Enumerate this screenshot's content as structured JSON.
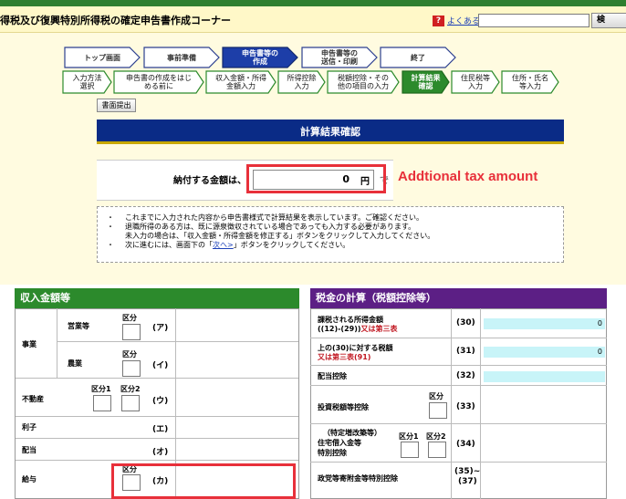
{
  "header": {
    "title": "得税及び復興特別所得税の確定申告書作成コーナー",
    "faq_icon": "?",
    "faq_label": "よくある質問",
    "search_placeholder": "",
    "search_button": "検"
  },
  "main_steps": [
    {
      "label": "トップ画面",
      "active": false
    },
    {
      "label": "事前準備",
      "active": false
    },
    {
      "label": "申告書等の\n作成",
      "active": true
    },
    {
      "label": "申告書等の\n送信・印刷",
      "active": false
    },
    {
      "label": "終了",
      "active": false
    }
  ],
  "sub_steps": [
    {
      "label": "入力方法\n選択",
      "active": false
    },
    {
      "label": "申告書の作成をはじ\nめる前に",
      "active": false
    },
    {
      "label": "収入金額・所得\n金額入力",
      "active": false
    },
    {
      "label": "所得控除\n入力",
      "active": false
    },
    {
      "label": "税額控除・その\n他の項目の入力",
      "active": false
    },
    {
      "label": "計算結果\n確認",
      "active": true
    },
    {
      "label": "住民税等\n入力",
      "active": false
    },
    {
      "label": "住所・氏名\n等入力",
      "active": false
    }
  ],
  "print_button": "書面提出",
  "page_title": "計算結果確認",
  "payment": {
    "label": "納付する金額は、",
    "value": "0",
    "unit": "円",
    "trailing": "で",
    "annotation": "Addtional tax amount"
  },
  "notes": {
    "line1": "これまでに入力された内容から申告書様式で計算結果を表示しています。ご確認ください。",
    "line2": "退職所得のある方は、既に源泉徴収されている場合であっても入力する必要があります。",
    "line3": "未入力の場合は、「収入金額・所得金額を修正する」ボタンをクリックして入力してください。",
    "line4_pre": "次に進むには、画面下の「",
    "line4_link": "次へ>",
    "line4_post": "」ボタンをクリックしてください。"
  },
  "income": {
    "header": "収入金額等",
    "jigyo": "事業",
    "eigyo": "営業等",
    "nogyo": "農業",
    "fudosan": "不動産",
    "rishi": "利子",
    "haito": "配当",
    "kyuyo": "給与",
    "kubun": "区分",
    "kubun1": "区分1",
    "kubun2": "区分2",
    "codes": [
      "(ア)",
      "(イ)",
      "(ウ)",
      "(エ)",
      "(オ)",
      "(カ)"
    ]
  },
  "tax": {
    "header": "税金の計算（税額控除等）",
    "row30_a": "課税される所得金額",
    "row30_b": "((12)-(29))",
    "row30_c": "又は第三表",
    "row30_code": "(30)",
    "row30_value": "0",
    "row31_a": "上の(30)に対する税額",
    "row31_b": "又は第三表(91)",
    "row31_code": "(31)",
    "row31_value": "0",
    "row32_label": "配当控除",
    "row32_code": "(32)",
    "row33_label": "投資税額等控除",
    "row33_kubun": "区分",
    "row33_code": "(33)",
    "row34_a": "（特定増改築等）",
    "row34_b": "住宅借入金等",
    "row34_c": "特別控除",
    "row34_kubun1": "区分1",
    "row34_kubun2": "区分2",
    "row34_code": "(34)",
    "row35_label": "政党等寄附金等特別控除",
    "row35_code_a": "(35)~",
    "row35_code_b": "(37)"
  }
}
